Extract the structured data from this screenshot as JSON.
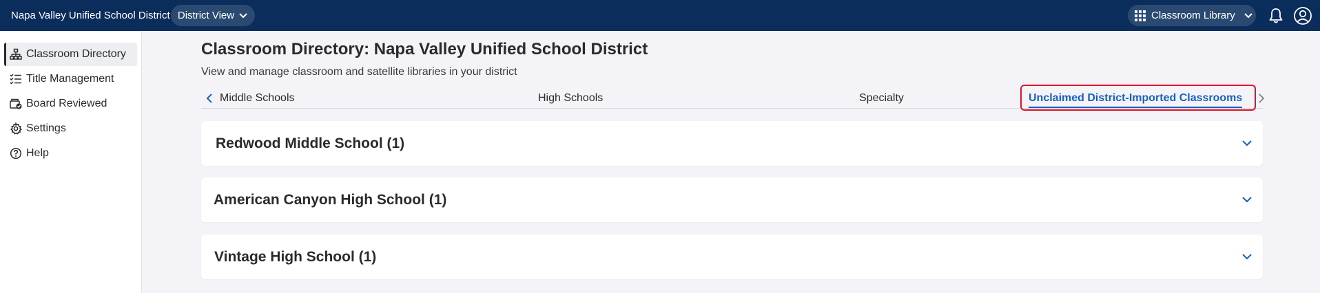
{
  "header": {
    "district_name": "Napa Valley Unified School District",
    "view_select": "District View",
    "library_select": "Classroom Library",
    "icons": {
      "grid": "apps-grid-icon",
      "bell": "bell-icon",
      "account": "account-circle-icon"
    }
  },
  "sidebar": {
    "items": [
      {
        "label": "Classroom Directory",
        "icon": "org-chart-icon",
        "active": true
      },
      {
        "label": "Title Management",
        "icon": "checklist-icon",
        "active": false
      },
      {
        "label": "Board Reviewed",
        "icon": "board-reviewed-icon",
        "active": false
      },
      {
        "label": "Settings",
        "icon": "gear-icon",
        "active": false
      },
      {
        "label": "Help",
        "icon": "help-icon",
        "active": false
      }
    ]
  },
  "main": {
    "title": "Classroom Directory: Napa Valley Unified School District",
    "subtitle": "View and manage classroom and satellite libraries in your district",
    "tabs": [
      {
        "label": "Middle Schools",
        "active": false
      },
      {
        "label": "High Schools",
        "active": false
      },
      {
        "label": "Specialty",
        "active": false
      },
      {
        "label": "Unclaimed District-Imported Classrooms",
        "active": true
      }
    ],
    "schools": [
      {
        "label": "Redwood Middle School (1)"
      },
      {
        "label": "American Canyon High School (1)"
      },
      {
        "label": "Vintage High School (1)"
      }
    ]
  },
  "colors": {
    "topbar": "#0a2d5c",
    "accent": "#1a5fbf",
    "highlight": "#e0102a",
    "background": "#f4f4f8"
  }
}
